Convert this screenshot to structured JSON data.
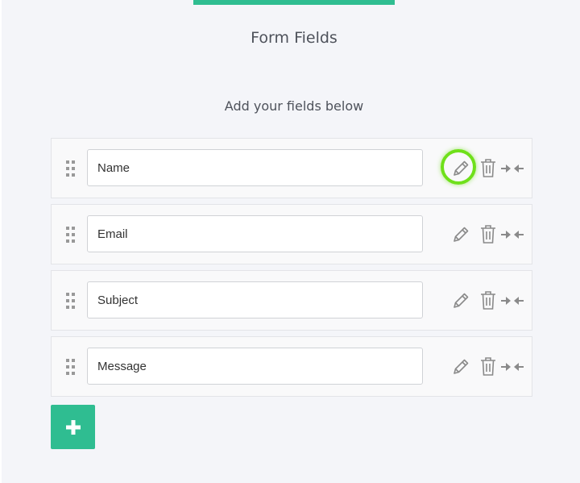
{
  "header": {
    "title": "Form Fields",
    "subtitle": "Add your fields below",
    "accent_color": "#2fbd91"
  },
  "fields": [
    {
      "value": "Name"
    },
    {
      "value": "Email"
    },
    {
      "value": "Subject"
    },
    {
      "value": "Message"
    }
  ],
  "icons": {
    "drag": "drag-handle-icon",
    "edit": "pencil-icon",
    "delete": "trash-icon",
    "resize": "arrows-collapse-icon",
    "add": "plus-icon"
  },
  "highlight": {
    "target": "edit-button",
    "row": 1,
    "color": "#6fe01a"
  }
}
